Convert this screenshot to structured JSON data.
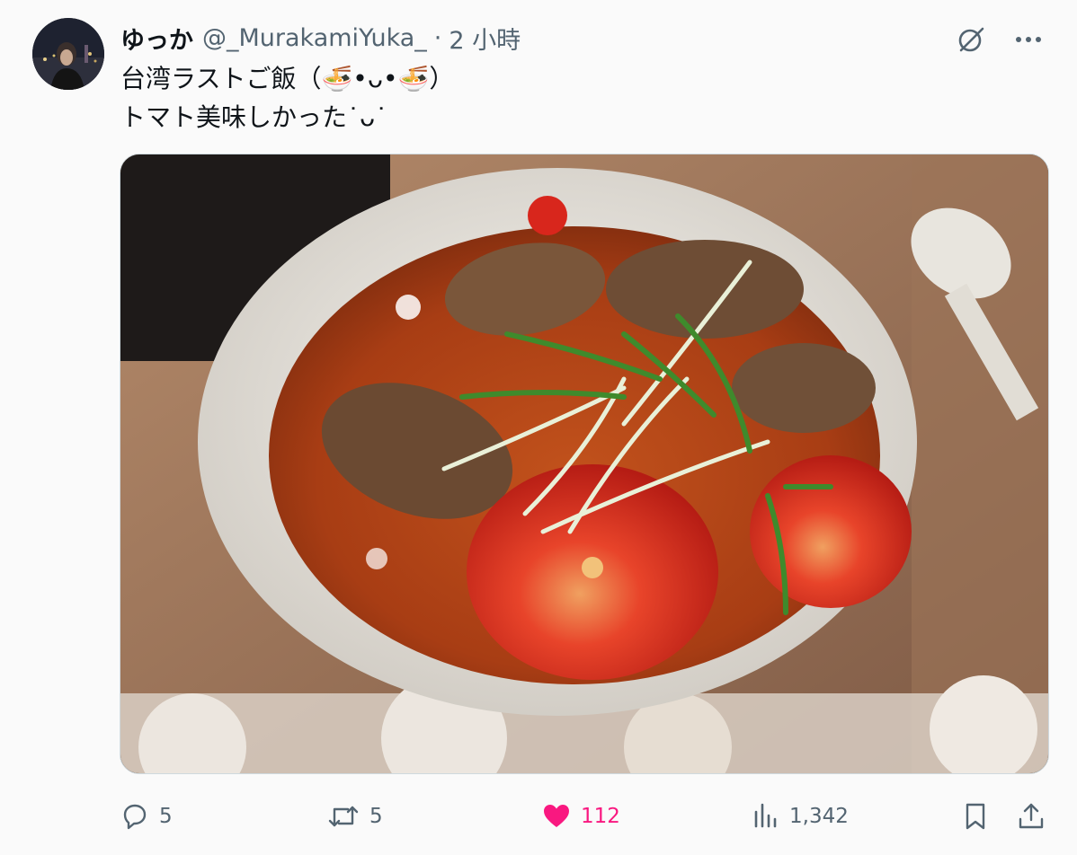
{
  "tweet": {
    "author": {
      "display_name": "ゆっか",
      "handle": "@_MurakamiYuka_",
      "avatar_icon": "avatar-photo"
    },
    "separator": "·",
    "time": "2 小時",
    "text_lines": [
      "台湾ラストご飯（🍜•ᴗ•🍜）",
      "トマト美味しかった˙ᴗ˙"
    ],
    "media": {
      "icon": "photo-tomato-beef-noodle-soup"
    }
  },
  "top_icons": [
    "grok-icon",
    "more-icon"
  ],
  "actions": {
    "reply": {
      "icon": "reply-icon",
      "count": "5"
    },
    "retweet": {
      "icon": "retweet-icon",
      "count": "5"
    },
    "like": {
      "icon": "heart-icon",
      "count": "112",
      "liked": true
    },
    "views": {
      "icon": "views-icon",
      "count": "1,342"
    },
    "bookmark": {
      "icon": "bookmark-icon"
    },
    "share": {
      "icon": "share-icon"
    }
  },
  "colors": {
    "text": "#0f1419",
    "secondary": "#536471",
    "like": "#f91880",
    "background": "#fafafa"
  }
}
